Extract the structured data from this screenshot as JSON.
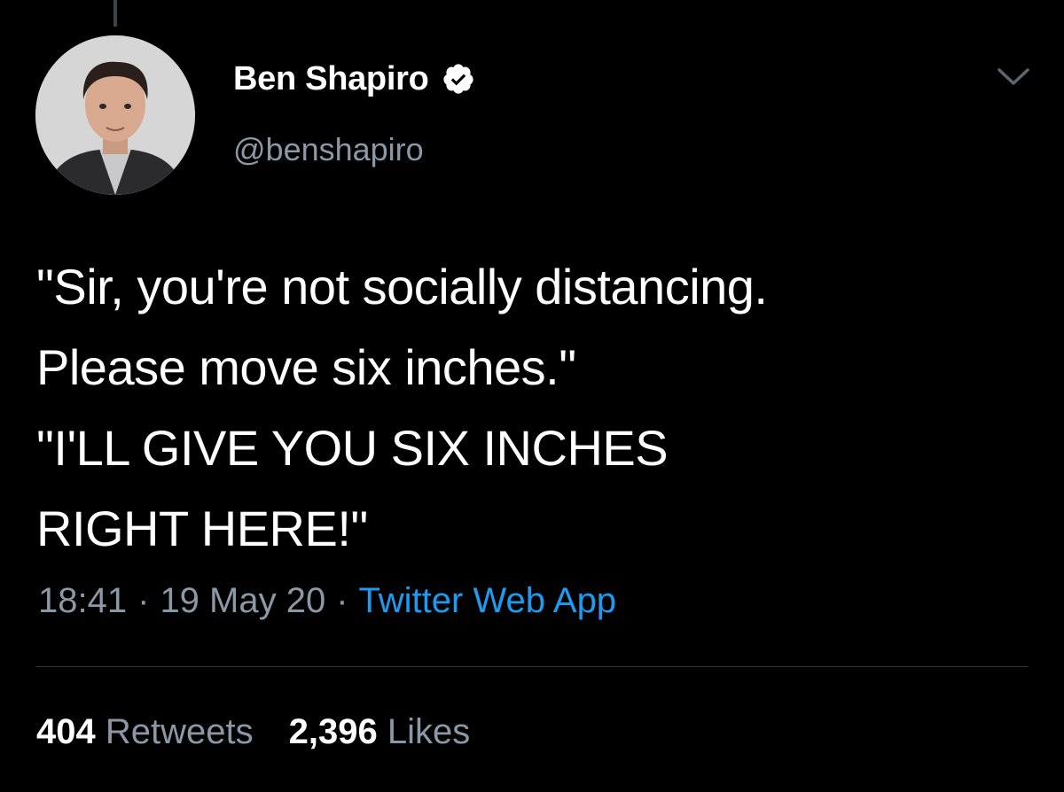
{
  "tweet": {
    "author": {
      "display_name": "Ben Shapiro",
      "handle": "@benshapiro",
      "verified": true
    },
    "text": "\"Sir, you're not socially distancing.\nPlease move six inches.\"\n\"I'LL GIVE YOU SIX INCHES\nRIGHT HERE!\"",
    "meta": {
      "time": "18:41",
      "separator": "·",
      "date": "19 May 20",
      "source": "Twitter Web App"
    },
    "stats": {
      "retweets_count": "404",
      "retweets_label": "Retweets",
      "likes_count": "2,396",
      "likes_label": "Likes"
    }
  },
  "icons": {
    "verified": "verified-badge-icon",
    "menu": "chevron-down-icon"
  },
  "colors": {
    "background": "#000000",
    "primary_text": "#ffffff",
    "secondary_text": "#8b98a5",
    "link": "#1d9bf0",
    "divider": "#2f3336"
  }
}
